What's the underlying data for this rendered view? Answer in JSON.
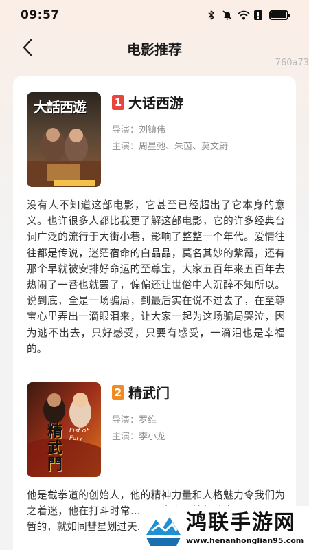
{
  "status": {
    "time": "09:57"
  },
  "header": {
    "title": "电影推荐",
    "watermark": "760a73"
  },
  "movies": [
    {
      "rank": "1",
      "rank_color": "#e8453c",
      "title": "大话西游",
      "poster_text": "大話西遊",
      "director_label": "导演：",
      "director": "刘镇伟",
      "cast_label": "主演：",
      "cast": "周星弛、朱茵、莫文蔚",
      "description": "没有人不知道这部电影，它甚至已经超出了它本身的意义。也许很多人都比我更了解这部电影，它的许多经典台词广泛的流行于大街小巷，影响了整整一个年代。爱情往往都是传说，迷茫宿命的白晶晶，莫名其妙的紫霞，还有那个早就被安排好命运的至尊宝，大家五百年来五百年去热闹了一番也就罢了，偏偏还让世俗中人沉醉不知所以。说到底，全是一场骗局，到最后实在说不过去了，在至尊宝心里弄出一滴眼泪来，让大家一起为这场骗局哭泣，因为逃不出去，只好感受，只要有感受，一滴泪也是幸福的。"
    },
    {
      "rank": "2",
      "rank_color": "#f08a24",
      "title": "精武门",
      "poster_text": "精武門",
      "poster_subtext": "Fist of Fury",
      "director_label": "导演：",
      "director": "罗维",
      "cast_label": "主演：",
      "cast": "李小龙",
      "description": "他是截拳道的创始人，他的精神力量和人格魅力令我们为之着迷，他在打斗时常……是当之无愧的功夫巨星一……暂的，就如同彗星划过天……"
    }
  ],
  "site": {
    "name": "鸿联手游网",
    "url": "www.henanhonglian95.com"
  },
  "colors": {
    "accent_red": "#e8453c",
    "accent_orange": "#f08a24"
  }
}
